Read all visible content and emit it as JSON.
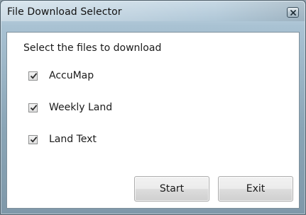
{
  "window": {
    "title": "File Download Selector",
    "close_icon": "close-icon"
  },
  "dialog": {
    "prompt": "Select the files to download",
    "options": [
      {
        "label": "AccuMap",
        "checked": true
      },
      {
        "label": "Weekly Land",
        "checked": true
      },
      {
        "label": "Land Text",
        "checked": true
      }
    ],
    "buttons": {
      "start_label": "Start",
      "exit_label": "Exit"
    }
  }
}
